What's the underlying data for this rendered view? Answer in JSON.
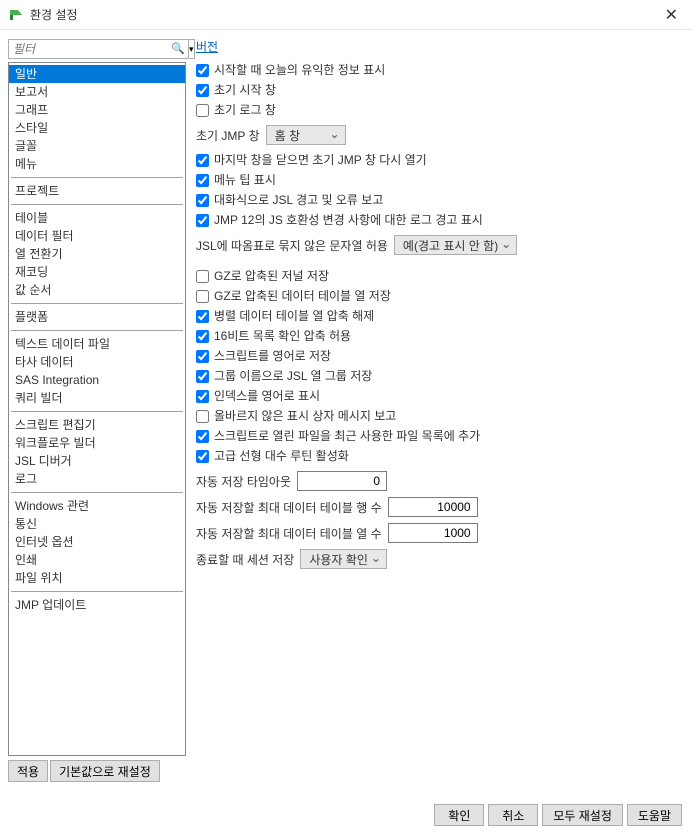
{
  "title": "환경 설정",
  "filter_placeholder": "필터",
  "version_link": "버전",
  "categories": [
    {
      "label": "일반",
      "sel": true
    },
    {
      "label": "보고서"
    },
    {
      "label": "그래프"
    },
    {
      "label": "스타일"
    },
    {
      "label": "글꼴"
    },
    {
      "label": "메뉴"
    },
    {
      "sep": true
    },
    {
      "label": "프로젝트"
    },
    {
      "sep": true
    },
    {
      "label": "테이블"
    },
    {
      "label": "데이터 필터"
    },
    {
      "label": "열 전환기"
    },
    {
      "label": "재코딩"
    },
    {
      "label": "값 순서"
    },
    {
      "sep": true
    },
    {
      "label": "플랫폼"
    },
    {
      "sep": true
    },
    {
      "label": "텍스트 데이터 파일"
    },
    {
      "label": "타사 데이터"
    },
    {
      "label": "SAS Integration"
    },
    {
      "label": "쿼리 빌더"
    },
    {
      "sep": true
    },
    {
      "label": "스크립트 편집기"
    },
    {
      "label": "워크플로우 빌더"
    },
    {
      "label": "JSL 디버거"
    },
    {
      "label": "로그"
    },
    {
      "sep": true
    },
    {
      "label": "Windows 관련"
    },
    {
      "label": "통신"
    },
    {
      "label": "인터넷 옵션"
    },
    {
      "label": "인쇄"
    },
    {
      "label": "파일 위치"
    },
    {
      "sep": true
    },
    {
      "label": "JMP 업데이트"
    }
  ],
  "left_buttons": {
    "apply": "적용",
    "reset": "기본값으로 재설정"
  },
  "checks1": [
    {
      "c": true,
      "t": "시작할 때 오늘의 유익한 정보 표시"
    },
    {
      "c": true,
      "t": "초기 시작 창"
    },
    {
      "c": false,
      "t": "초기 로그 창"
    }
  ],
  "init_window": {
    "label": "초기 JMP 창",
    "value": "홈 창"
  },
  "checks2": [
    {
      "c": true,
      "t": "마지막 창을 닫으면 초기 JMP 창 다시 열기"
    },
    {
      "c": true,
      "t": "메뉴 팁 표시"
    },
    {
      "c": true,
      "t": "대화식으로 JSL 경고 및 오류 보고"
    },
    {
      "c": true,
      "t": "JMP 12의 JS 호환성 변경 사항에 대한 로그 경고 표시"
    }
  ],
  "jsl_quote": {
    "label": "JSL에 따옴표로 묶지 않은 문자열 허용",
    "value": "예(경고 표시 안 함)"
  },
  "checks3": [
    {
      "c": false,
      "t": "GZ로 압축된 저널 저장"
    },
    {
      "c": false,
      "t": "GZ로 압축된 데이터 테이블 열 저장"
    },
    {
      "c": true,
      "t": "병렬 데이터 테이블 열 압축 해제"
    },
    {
      "c": true,
      "t": "16비트 목록 확인 압축 허용"
    },
    {
      "c": true,
      "t": "스크립트를 영어로 저장"
    },
    {
      "c": true,
      "t": "그룹 이름으로 JSL 열 그룹 저장"
    },
    {
      "c": true,
      "t": "인덱스를 영어로 표시"
    },
    {
      "c": false,
      "t": "올바르지 않은 표시 상자 메시지 보고"
    },
    {
      "c": true,
      "t": "스크립트로 열린 파일을 최근 사용한 파일 목록에 추가"
    },
    {
      "c": true,
      "t": "고급 선형 대수 루틴 활성화"
    }
  ],
  "autosave_timeout": {
    "label": "자동 저장 타임아웃",
    "value": "0"
  },
  "autosave_rows": {
    "label": "자동 저장할 최대 데이터 테이블 행 수",
    "value": "10000"
  },
  "autosave_cols": {
    "label": "자동 저장할 최대 데이터 테이블 열 수",
    "value": "1000"
  },
  "session_save": {
    "label": "종료할 때 세션 저장",
    "value": "사용자 확인"
  },
  "footer": {
    "ok": "확인",
    "cancel": "취소",
    "reset_all": "모두 재설정",
    "help": "도움말"
  }
}
